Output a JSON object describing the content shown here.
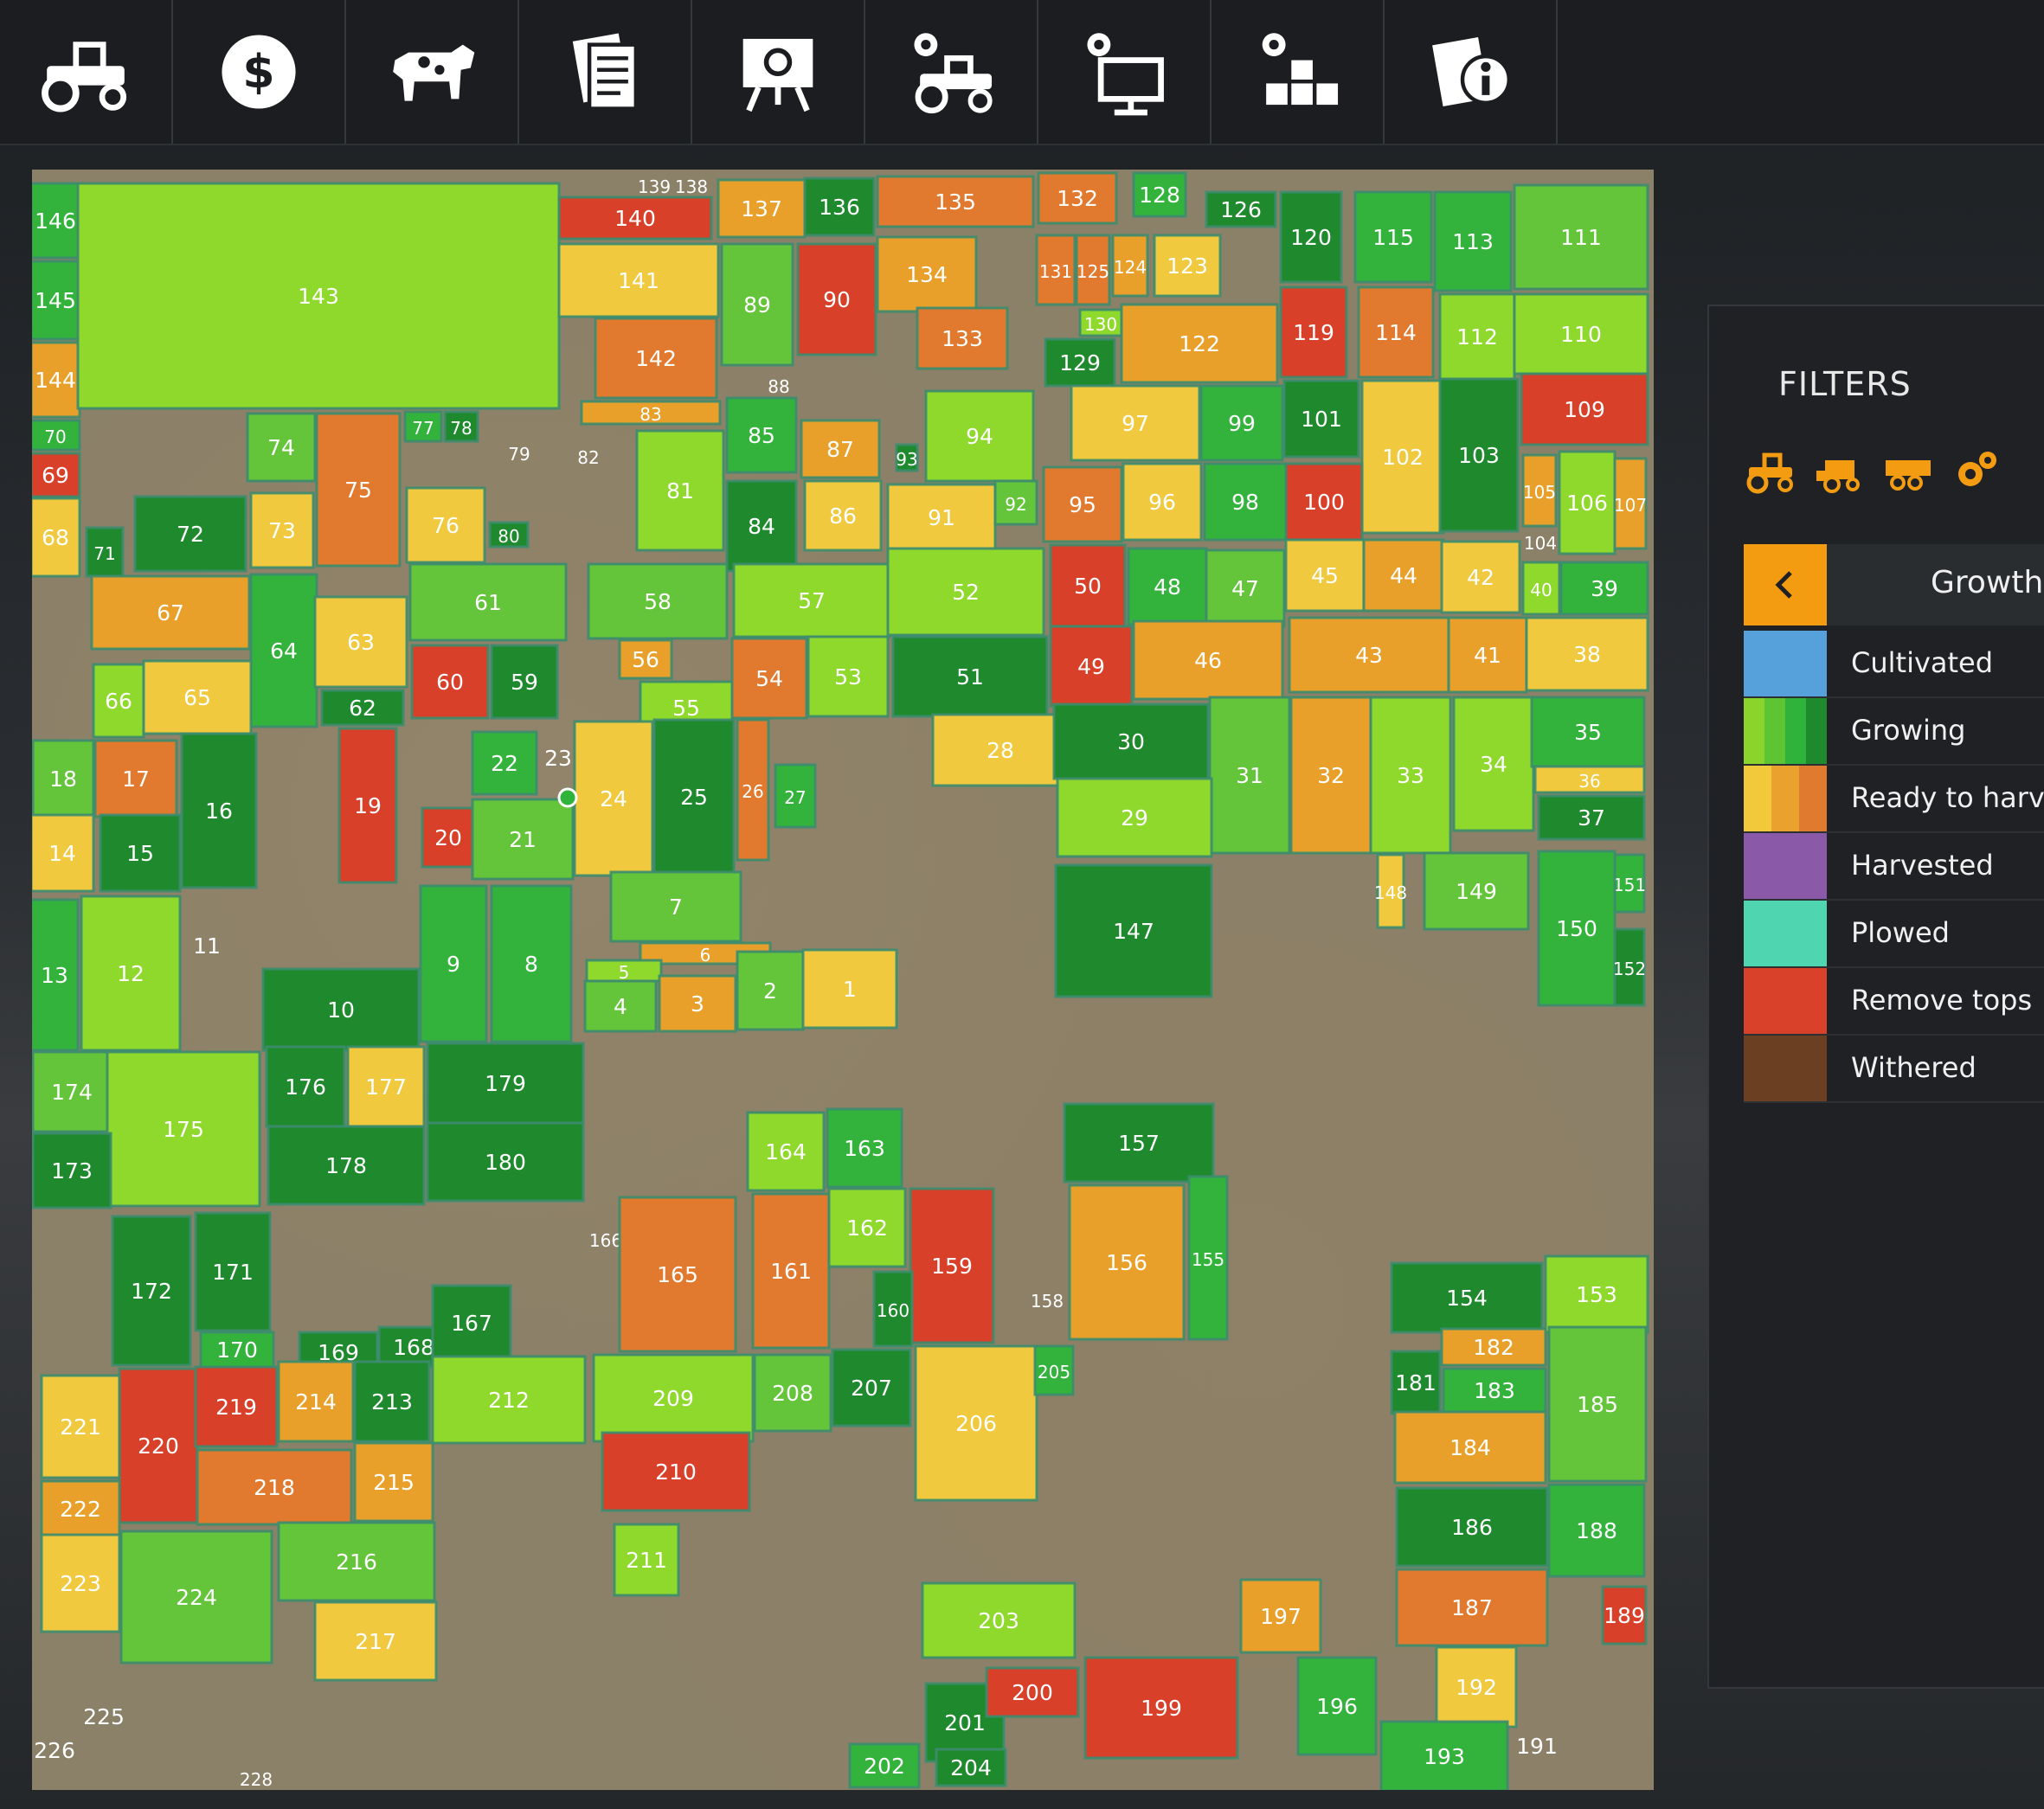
{
  "topbar": {
    "tabs": [
      {
        "name": "vehicles",
        "icon": "tractor-icon"
      },
      {
        "name": "finances",
        "icon": "dollar-icon"
      },
      {
        "name": "animals",
        "icon": "cow-icon"
      },
      {
        "name": "contracts",
        "icon": "documents-icon"
      },
      {
        "name": "statistics",
        "icon": "presentation-icon"
      },
      {
        "name": "garage",
        "icon": "tractor-gear-icon"
      },
      {
        "name": "settings",
        "icon": "monitor-gear-icon"
      },
      {
        "name": "production",
        "icon": "boxes-gear-icon"
      },
      {
        "name": "help",
        "icon": "info-document-icon"
      }
    ]
  },
  "filters": {
    "title": "FILTERS",
    "filter_icons": [
      "tractor-icon",
      "harvester-icon",
      "trailer-icon",
      "gears-icon"
    ],
    "mode_label": "Growth",
    "legend": [
      {
        "label": "Cultivated",
        "colors": [
          "#56a0dc"
        ]
      },
      {
        "label": "Growing",
        "colors": [
          "#8bd42c",
          "#5fc434",
          "#2fb33a",
          "#1f8a2d"
        ]
      },
      {
        "label": "Ready to harve",
        "colors": [
          "#f2c93a",
          "#eaa12d",
          "#e07a2e"
        ]
      },
      {
        "label": "Harvested",
        "colors": [
          "#8a5aa8"
        ]
      },
      {
        "label": "Plowed",
        "colors": [
          "#4fd6b0"
        ]
      },
      {
        "label": "Remove tops",
        "colors": [
          "#d9412a"
        ]
      },
      {
        "label": "Withered",
        "colors": [
          "#6a3f22"
        ]
      }
    ]
  },
  "palette": {
    "G1": "#8fd82c",
    "G2": "#64c43a",
    "G3": "#33b33c",
    "G4": "#1f8a2d",
    "R1": "#f0c93f",
    "R2": "#e9a02a",
    "R3": "#e17a2e",
    "RT": "#d9402a",
    "PL": "#4fd6b0"
  },
  "fields": [
    [
      "146",
      "G3"
    ],
    [
      "145",
      "G3"
    ],
    [
      "144",
      "R2"
    ],
    [
      "70",
      "G3"
    ],
    [
      "69",
      "RT"
    ],
    [
      "68",
      "R1"
    ],
    [
      "71",
      "G4"
    ],
    [
      "143",
      "G1"
    ],
    [
      "140",
      "RT"
    ],
    [
      "139",
      ""
    ],
    [
      "138",
      ""
    ],
    [
      "137",
      "R2"
    ],
    [
      "136",
      "G4"
    ],
    [
      "135",
      "R3"
    ],
    [
      "132",
      "R3"
    ],
    [
      "128",
      "G3"
    ],
    [
      "126",
      "G4"
    ],
    [
      "141",
      "R1"
    ],
    [
      "89",
      "G2"
    ],
    [
      "90",
      "RT"
    ],
    [
      "134",
      "R2"
    ],
    [
      "131",
      "R3"
    ],
    [
      "125",
      "R3"
    ],
    [
      "124",
      "R2"
    ],
    [
      "123",
      "R1"
    ],
    [
      "120",
      "G4"
    ],
    [
      "115",
      "G3"
    ],
    [
      "113",
      "G3"
    ],
    [
      "111",
      "G2"
    ],
    [
      "142",
      "R3"
    ],
    [
      "133",
      "R3"
    ],
    [
      "130",
      "G1"
    ],
    [
      "129",
      "G4"
    ],
    [
      "122",
      "R2"
    ],
    [
      "119",
      "RT"
    ],
    [
      "114",
      "R3"
    ],
    [
      "112",
      "G1"
    ],
    [
      "110",
      "G1"
    ],
    [
      "88",
      ""
    ],
    [
      "83",
      "R2"
    ],
    [
      "85",
      "G3"
    ],
    [
      "87",
      "R2"
    ],
    [
      "94",
      "G1"
    ],
    [
      "93",
      "G4"
    ],
    [
      "97",
      "R1"
    ],
    [
      "99",
      "G3"
    ],
    [
      "101",
      "G4"
    ],
    [
      "102",
      "R1"
    ],
    [
      "103",
      "G4"
    ],
    [
      "109",
      "RT"
    ],
    [
      "74",
      "G2"
    ],
    [
      "75",
      "R3"
    ],
    [
      "77",
      "G3"
    ],
    [
      "78",
      "G4"
    ],
    [
      "79",
      ""
    ],
    [
      "82",
      ""
    ],
    [
      "81",
      "G1"
    ],
    [
      "84",
      "G4"
    ],
    [
      "86",
      "R1"
    ],
    [
      "91",
      "R1"
    ],
    [
      "92",
      "G2"
    ],
    [
      "95",
      "R3"
    ],
    [
      "96",
      "R1"
    ],
    [
      "98",
      "G3"
    ],
    [
      "100",
      "RT"
    ],
    [
      "105",
      "R2"
    ],
    [
      "106",
      "G1"
    ],
    [
      "107",
      "R2"
    ],
    [
      "104",
      ""
    ],
    [
      "72",
      "G4"
    ],
    [
      "73",
      "R1"
    ],
    [
      "76",
      "R1"
    ],
    [
      "80",
      "G4"
    ],
    [
      "67",
      "R2"
    ],
    [
      "64",
      "G3"
    ],
    [
      "63",
      "R1"
    ],
    [
      "61",
      "G2"
    ],
    [
      "58",
      "G2"
    ],
    [
      "57",
      "G1"
    ],
    [
      "52",
      "G1"
    ],
    [
      "50",
      "RT"
    ],
    [
      "48",
      "G3"
    ],
    [
      "47",
      "G2"
    ],
    [
      "45",
      "R1"
    ],
    [
      "44",
      "R2"
    ],
    [
      "42",
      "R1"
    ],
    [
      "40",
      "G1"
    ],
    [
      "39",
      "G3"
    ],
    [
      "66",
      "G1"
    ],
    [
      "65",
      "R1"
    ],
    [
      "62",
      "G4"
    ],
    [
      "60",
      "RT"
    ],
    [
      "59",
      "G4"
    ],
    [
      "56",
      "R2"
    ],
    [
      "55",
      "G1"
    ],
    [
      "54",
      "R3"
    ],
    [
      "53",
      "G1"
    ],
    [
      "51",
      "G4"
    ],
    [
      "49",
      "RT"
    ],
    [
      "46",
      "R2"
    ],
    [
      "43",
      "R2"
    ],
    [
      "41",
      "R2"
    ],
    [
      "38",
      "R1"
    ],
    [
      "18",
      "G2"
    ],
    [
      "17",
      "R3"
    ],
    [
      "16",
      "G4"
    ],
    [
      "19",
      "RT"
    ],
    [
      "22",
      "G3"
    ],
    [
      "23",
      ""
    ],
    [
      "24",
      "R1"
    ],
    [
      "25",
      "G4"
    ],
    [
      "26",
      "R3"
    ],
    [
      "27",
      "G3"
    ],
    [
      "28",
      "R1"
    ],
    [
      "30",
      "G4"
    ],
    [
      "31",
      "G2"
    ],
    [
      "32",
      "R2"
    ],
    [
      "33",
      "G1"
    ],
    [
      "34",
      "G1"
    ],
    [
      "35",
      "G3"
    ],
    [
      "36",
      "R1"
    ],
    [
      "37",
      "G4"
    ],
    [
      "14",
      "R1"
    ],
    [
      "15",
      "G4"
    ],
    [
      "20",
      "RT"
    ],
    [
      "21",
      "G2"
    ],
    [
      "29",
      "G1"
    ],
    [
      "148",
      "R1"
    ],
    [
      "149",
      "G2"
    ],
    [
      "151",
      "G3"
    ],
    [
      "150",
      "G3"
    ],
    [
      "152",
      "G4"
    ],
    [
      "13",
      "G3"
    ],
    [
      "12",
      "G1"
    ],
    [
      "11",
      ""
    ],
    [
      "7",
      "G2"
    ],
    [
      "9",
      "G3"
    ],
    [
      "8",
      "G3"
    ],
    [
      "6",
      "R2"
    ],
    [
      "5",
      "G1"
    ],
    [
      "2",
      "G2"
    ],
    [
      "1",
      "R1"
    ],
    [
      "147",
      "G4"
    ],
    [
      "10",
      "G4"
    ],
    [
      "4",
      "G2"
    ],
    [
      "3",
      "R2"
    ],
    [
      "174",
      "G2"
    ],
    [
      "176",
      "G4"
    ],
    [
      "177",
      "R1"
    ],
    [
      "179",
      "G4"
    ],
    [
      "175",
      "G1"
    ],
    [
      "173",
      "G4"
    ],
    [
      "178",
      "G4"
    ],
    [
      "180",
      "G4"
    ],
    [
      "164",
      "G1"
    ],
    [
      "163",
      "G3"
    ],
    [
      "157",
      "G4"
    ],
    [
      "172",
      "G4"
    ],
    [
      "171",
      "G4"
    ],
    [
      "166",
      ""
    ],
    [
      "165",
      "R3"
    ],
    [
      "161",
      "R3"
    ],
    [
      "162",
      "G1"
    ],
    [
      "159",
      "RT"
    ],
    [
      "156",
      "R2"
    ],
    [
      "155",
      "G3"
    ],
    [
      "158",
      ""
    ],
    [
      "160",
      "G4"
    ],
    [
      "154",
      "G4"
    ],
    [
      "153",
      "G1"
    ],
    [
      "170",
      "G3"
    ],
    [
      "169",
      "G4"
    ],
    [
      "168",
      "G4"
    ],
    [
      "167",
      "G4"
    ],
    [
      "182",
      "R2"
    ],
    [
      "181",
      "G4"
    ],
    [
      "183",
      "G3"
    ],
    [
      "185",
      "G2"
    ],
    [
      "221",
      "R1"
    ],
    [
      "220",
      "RT"
    ],
    [
      "219",
      "RT"
    ],
    [
      "214",
      "R2"
    ],
    [
      "213",
      "G4"
    ],
    [
      "212",
      "G1"
    ],
    [
      "209",
      "G1"
    ],
    [
      "208",
      "G2"
    ],
    [
      "207",
      "G4"
    ],
    [
      "206",
      "R1"
    ],
    [
      "205",
      "G3"
    ],
    [
      "184",
      "R2"
    ],
    [
      "222",
      "R2"
    ],
    [
      "218",
      "R3"
    ],
    [
      "215",
      "R2"
    ],
    [
      "210",
      "RT"
    ],
    [
      "186",
      "G4"
    ],
    [
      "188",
      "G3"
    ],
    [
      "223",
      "R1"
    ],
    [
      "224",
      "G2"
    ],
    [
      "216",
      "G2"
    ],
    [
      "211",
      "G1"
    ],
    [
      "217",
      "R1"
    ],
    [
      "203",
      "G1"
    ],
    [
      "197",
      "R2"
    ],
    [
      "187",
      "R3"
    ],
    [
      "189",
      "RT"
    ],
    [
      "225",
      ""
    ],
    [
      "226",
      ""
    ],
    [
      "228",
      ""
    ],
    [
      "201",
      "G4"
    ],
    [
      "200",
      "RT"
    ],
    [
      "199",
      "RT"
    ],
    [
      "196",
      "G3"
    ],
    [
      "192",
      "R1"
    ],
    [
      "193",
      "G3"
    ],
    [
      "191",
      ""
    ],
    [
      "202",
      "G3"
    ],
    [
      "204",
      "G4"
    ]
  ]
}
